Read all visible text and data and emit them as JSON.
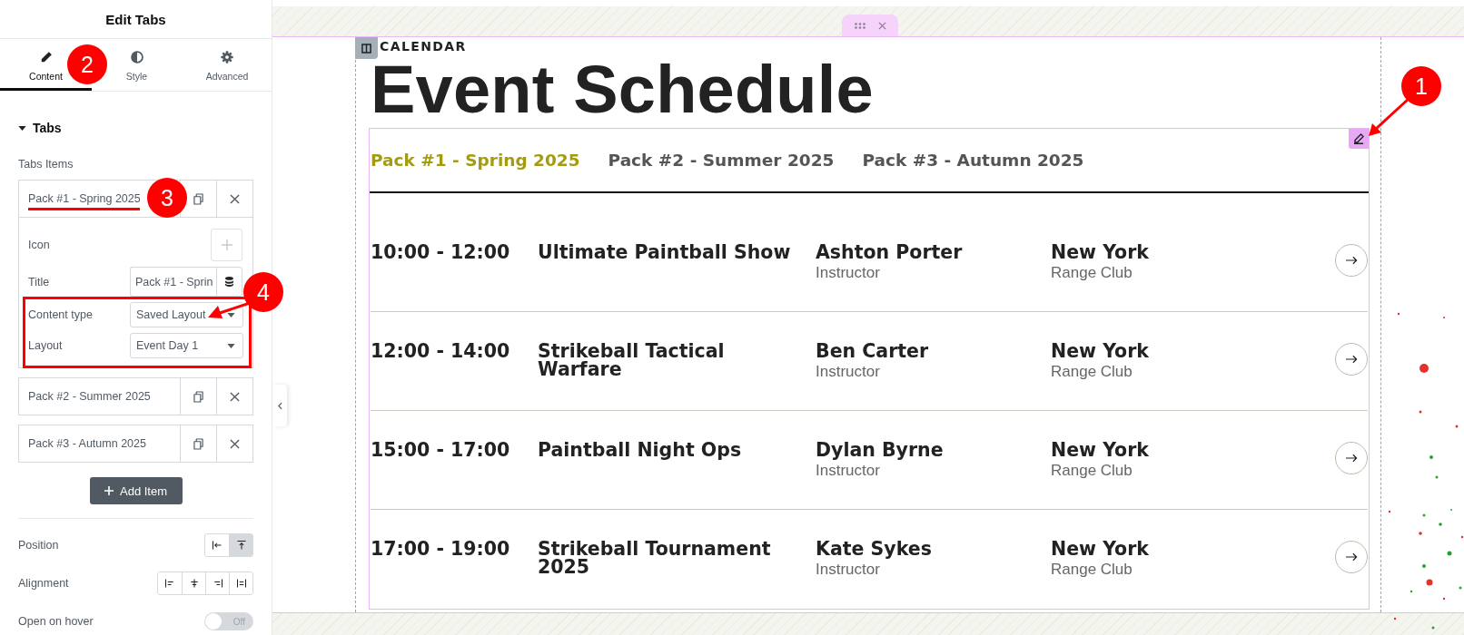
{
  "panel": {
    "title": "Edit Tabs",
    "tabs": [
      {
        "label": "Content",
        "selected": true
      },
      {
        "label": "Style",
        "selected": false
      },
      {
        "label": "Advanced",
        "selected": false
      }
    ],
    "section": {
      "title": "Tabs",
      "expanded": true
    },
    "repeater": {
      "label": "Tabs Items",
      "items": [
        {
          "label": "Pack #1 - Spring 2025",
          "expanded": true,
          "fields": [
            {
              "kind": "icon",
              "label": "Icon"
            },
            {
              "kind": "text",
              "label": "Title",
              "value": "Pack #1 - Sprin"
            },
            {
              "kind": "select",
              "label": "Content type",
              "value": "Saved Layout"
            },
            {
              "kind": "select",
              "label": "Layout",
              "value": "Event Day 1"
            }
          ]
        },
        {
          "label": "Pack #2 - Summer 2025",
          "expanded": false
        },
        {
          "label": "Pack #3 - Autumn 2025",
          "expanded": false
        }
      ],
      "add_button": "Add Item"
    },
    "controls": [
      {
        "kind": "choice",
        "label": "Position",
        "options": [
          {
            "selected": false
          },
          {
            "selected": true
          }
        ]
      },
      {
        "kind": "choice",
        "label": "Alignment",
        "options": [
          {
            "selected": false
          },
          {
            "selected": false
          },
          {
            "selected": false
          },
          {
            "selected": false
          }
        ]
      },
      {
        "kind": "switch",
        "label": "Open on hover",
        "on": false,
        "state_text": "Off"
      }
    ]
  },
  "canvas": {
    "eyebrow": "CALENDAR",
    "heading": "Event Schedule",
    "tabs": [
      {
        "label": "Pack #1 - Spring 2025",
        "selected": true
      },
      {
        "label": "Pack #2 - Summer 2025",
        "selected": false
      },
      {
        "label": "Pack #3 - Autumn 2025",
        "selected": false
      }
    ],
    "events": [
      {
        "time": "10:00 - 12:00",
        "title": "Ultimate Paintball Show",
        "person": "Ashton Porter",
        "role": "Instructor",
        "city": "New York",
        "venue": "Range Club"
      },
      {
        "time": "12:00 - 14:00",
        "title": "Strikeball Tactical Warfare",
        "person": "Ben Carter",
        "role": "Instructor",
        "city": "New York",
        "venue": "Range Club"
      },
      {
        "time": "15:00 - 17:00",
        "title": "Paintball Night Ops",
        "person": "Dylan Byrne",
        "role": "Instructor",
        "city": "New York",
        "venue": "Range Club"
      },
      {
        "time": "17:00 - 19:00",
        "title": "Strikeball Tournament 2025",
        "person": "Kate Sykes",
        "role": "Instructor",
        "city": "New York",
        "venue": "Range Club"
      }
    ]
  },
  "annotations": [
    {
      "label": "1"
    },
    {
      "label": "2"
    },
    {
      "label": "3"
    },
    {
      "label": "4"
    }
  ]
}
